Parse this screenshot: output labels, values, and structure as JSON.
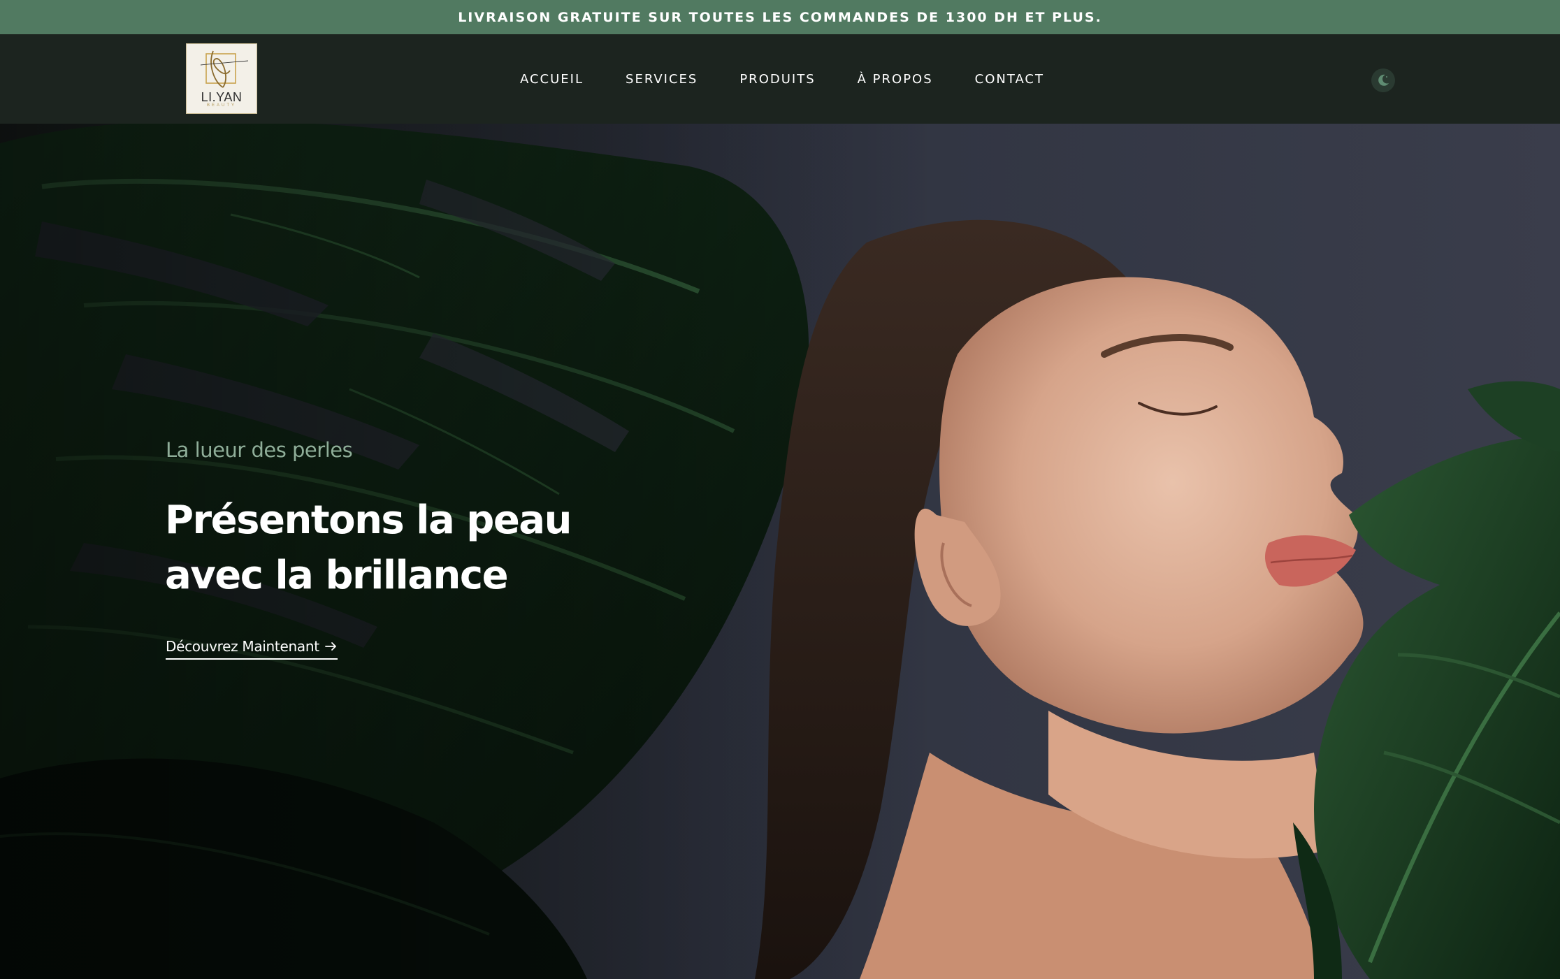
{
  "announcement": {
    "text": "LIVRAISON GRATUITE SUR TOUTES LES COMMANDES DE 1300 DH ET PLUS."
  },
  "brand": {
    "name": "LI.YAN",
    "tagline": "BEAUTY"
  },
  "nav": {
    "items": [
      {
        "label": "ACCUEIL"
      },
      {
        "label": "SERVICES"
      },
      {
        "label": "PRODUITS"
      },
      {
        "label": "À PROPOS"
      },
      {
        "label": "CONTACT"
      }
    ],
    "theme_toggle_icon": "moon-icon"
  },
  "hero": {
    "eyebrow": "La lueur des perles",
    "title_line1": "Présentons la peau",
    "title_line2": "avec la brillance",
    "cta_label": "Découvrez Maintenant",
    "cta_icon": "arrow-right-icon"
  },
  "colors": {
    "announcement_bg": "#517a61",
    "header_bg": "#1c241f",
    "accent_green": "#8fae99"
  }
}
